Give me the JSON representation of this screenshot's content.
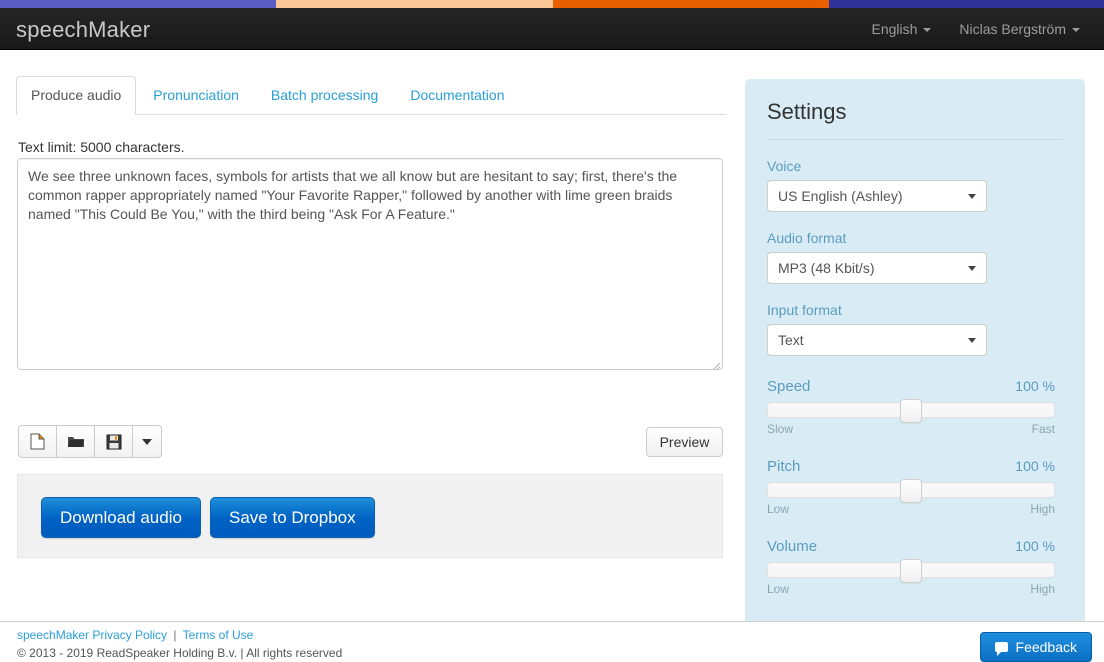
{
  "loadbar": {
    "segments": [
      {
        "name": "purple",
        "color": "#5a5ec4",
        "width_pct": 25.0
      },
      {
        "name": "peach",
        "color": "#fac898",
        "width_pct": 25.1
      },
      {
        "name": "orange",
        "color": "#e85f00",
        "width_pct": 25.0
      },
      {
        "name": "darkblue",
        "color": "#2f3299",
        "width_pct": 24.9
      }
    ]
  },
  "navbar": {
    "brand": "speechMaker",
    "language_menu": "English",
    "user_menu": "Niclas Bergström"
  },
  "tabs": [
    {
      "label": "Produce audio",
      "active": true
    },
    {
      "label": "Pronunciation",
      "active": false
    },
    {
      "label": "Batch processing",
      "active": false
    },
    {
      "label": "Documentation",
      "active": false
    }
  ],
  "editor": {
    "text_limit_label": "Text limit: 5000 characters.",
    "textarea_value": "We see three unknown faces, symbols for artists that we all know but are hesitant to say; first, there's the common rapper appropriately named \"Your Favorite Rapper,\" followed by another with lime green braids named \"This Could Be You,\" with the third being \"Ask For A Feature.\"",
    "textarea_placeholder": "",
    "toolbar": [
      {
        "icon": "new-document-icon",
        "title": "New"
      },
      {
        "icon": "open-folder-icon",
        "title": "Open"
      },
      {
        "icon": "save-floppy-icon",
        "title": "Save"
      },
      {
        "icon": "caret-down-icon",
        "title": "More"
      }
    ],
    "preview_label": "Preview"
  },
  "actions": {
    "download_label": "Download audio",
    "dropbox_label": "Save to Dropbox",
    "button_color": "#0062c4"
  },
  "settings": {
    "title": "Settings",
    "voice": {
      "label": "Voice",
      "value": "US English (Ashley)"
    },
    "audio_format": {
      "label": "Audio format",
      "value": "MP3 (48 Kbit/s)"
    },
    "input_format": {
      "label": "Input format",
      "value": "Text"
    },
    "sliders": [
      {
        "name": "speed",
        "label": "Speed",
        "value": "100 %",
        "percent": 50,
        "min_label": "Slow",
        "max_label": "Fast"
      },
      {
        "name": "pitch",
        "label": "Pitch",
        "value": "100 %",
        "percent": 50,
        "min_label": "Low",
        "max_label": "High"
      },
      {
        "name": "volume",
        "label": "Volume",
        "value": "100 %",
        "percent": 50,
        "min_label": "Low",
        "max_label": "High"
      }
    ],
    "panel_color": "#d9ecf6",
    "label_color": "#5a9cc0"
  },
  "footer": {
    "privacy_link": "speechMaker Privacy Policy",
    "separator": "|",
    "terms_link": "Terms of Use",
    "copyright": "© 2013 - 2019 ReadSpeaker Holding B.v. | All rights reserved",
    "feedback_label": "Feedback"
  }
}
